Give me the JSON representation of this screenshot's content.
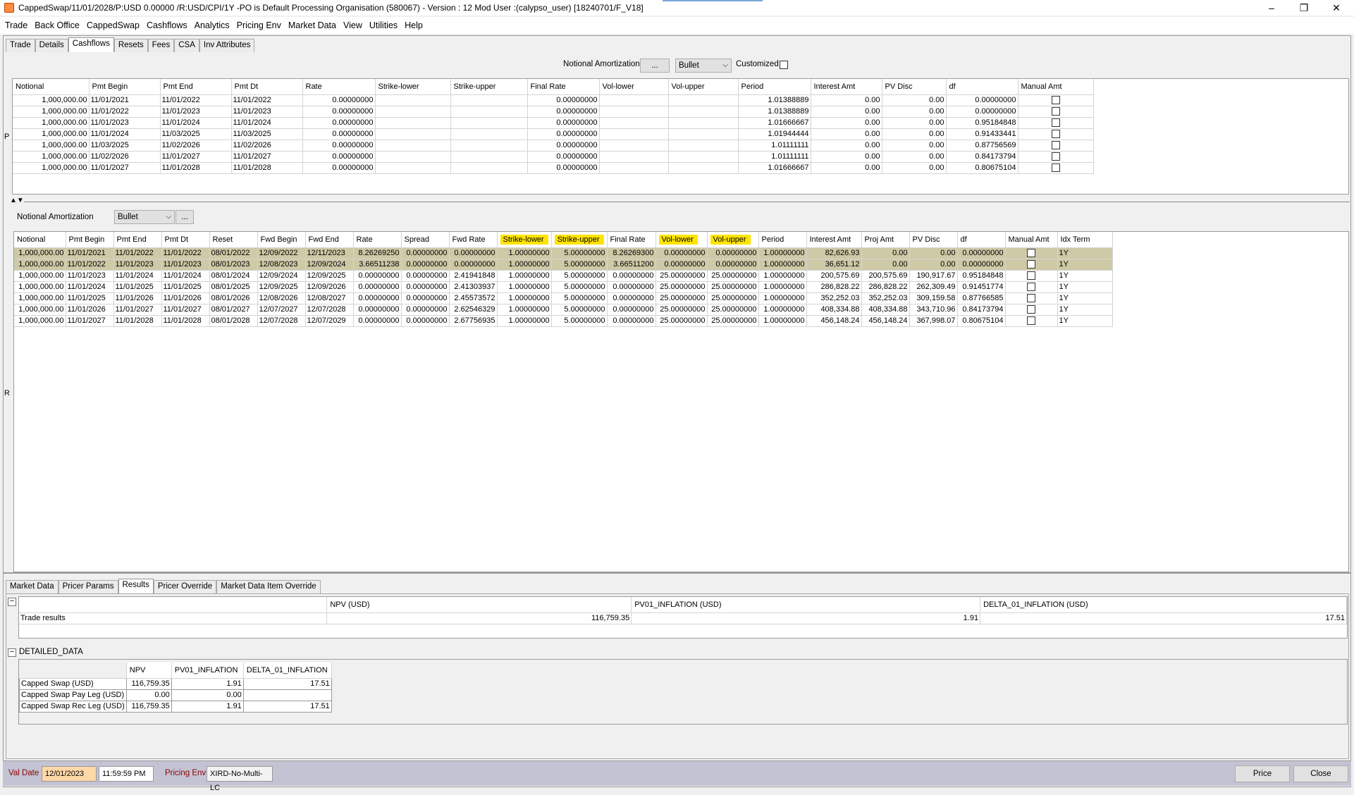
{
  "window": {
    "title": "CappedSwap/11/01/2028/P:USD 0.00000 /R:USD/CPI/1Y  -PO is Default Processing Organisation  (580067) - Version : 12 Mod User :(calypso_user)  [18240701/F_V18]",
    "minimize": "–",
    "restore": "❐",
    "close": "✕"
  },
  "menu": [
    "Trade",
    "Back Office",
    "CappedSwap",
    "Cashflows",
    "Analytics",
    "Pricing Env",
    "Market Data",
    "View",
    "Utilities",
    "Help"
  ],
  "top_tabs": [
    {
      "label": "Trade"
    },
    {
      "label": "Details"
    },
    {
      "label": "Cashflows",
      "active": true
    },
    {
      "label": "Resets"
    },
    {
      "label": "Fees"
    },
    {
      "label": "CSA"
    },
    {
      "label": "Inv Attributes"
    }
  ],
  "pay_leg": {
    "side_label": "P",
    "amort_label": "Notional Amortization",
    "amort_button": "...",
    "amort_value": "Bullet",
    "customized_label": "Customized",
    "columns": [
      "Notional",
      "Pmt Begin",
      "Pmt End",
      "Pmt Dt",
      "Rate",
      "Strike-lower",
      "Strike-upper",
      "Final Rate",
      "Vol-lower",
      "Vol-upper",
      "Period",
      "Interest Amt",
      "PV Disc",
      "df",
      "Manual Amt"
    ],
    "rows": [
      [
        "1,000,000.00",
        "11/01/2021",
        "11/01/2022",
        "11/01/2022",
        "0.00000000",
        "",
        "",
        "0.00000000",
        "",
        "",
        "1.01388889",
        "0.00",
        "0.00",
        "0.00000000"
      ],
      [
        "1,000,000.00",
        "11/01/2022",
        "11/01/2023",
        "11/01/2023",
        "0.00000000",
        "",
        "",
        "0.00000000",
        "",
        "",
        "1.01388889",
        "0.00",
        "0.00",
        "0.00000000"
      ],
      [
        "1,000,000.00",
        "11/01/2023",
        "11/01/2024",
        "11/01/2024",
        "0.00000000",
        "",
        "",
        "0.00000000",
        "",
        "",
        "1.01666667",
        "0.00",
        "0.00",
        "0.95184848"
      ],
      [
        "1,000,000.00",
        "11/01/2024",
        "11/03/2025",
        "11/03/2025",
        "0.00000000",
        "",
        "",
        "0.00000000",
        "",
        "",
        "1.01944444",
        "0.00",
        "0.00",
        "0.91433441"
      ],
      [
        "1,000,000.00",
        "11/03/2025",
        "11/02/2026",
        "11/02/2026",
        "0.00000000",
        "",
        "",
        "0.00000000",
        "",
        "",
        "1.01111111",
        "0.00",
        "0.00",
        "0.87756569"
      ],
      [
        "1,000,000.00",
        "11/02/2026",
        "11/01/2027",
        "11/01/2027",
        "0.00000000",
        "",
        "",
        "0.00000000",
        "",
        "",
        "1.01111111",
        "0.00",
        "0.00",
        "0.84173794"
      ],
      [
        "1,000,000.00",
        "11/01/2027",
        "11/01/2028",
        "11/01/2028",
        "0.00000000",
        "",
        "",
        "0.00000000",
        "",
        "",
        "1.01666667",
        "0.00",
        "0.00",
        "0.80675104"
      ]
    ]
  },
  "rec_leg": {
    "side_label": "R",
    "amort_label": "Notional Amortization",
    "amort_value": "Bullet",
    "amort_button": "...",
    "columns": [
      "Notional",
      "Pmt Begin",
      "Pmt End",
      "Pmt Dt",
      "Reset",
      "Fwd Begin",
      "Fwd End",
      "Rate",
      "Spread",
      "Fwd Rate",
      "Strike-lower",
      "Strike-upper",
      "Final Rate",
      "Vol-lower",
      "Vol-upper",
      "Period",
      "Interest Amt",
      "Proj Amt",
      "PV Disc",
      "df",
      "Manual Amt",
      "Idx Term"
    ],
    "highlight_cols": [
      10,
      11,
      13,
      14
    ],
    "rows": [
      [
        "1,000,000.00",
        "11/01/2021",
        "11/01/2022",
        "11/01/2022",
        "08/01/2022",
        "12/09/2022",
        "12/11/2023",
        "8.26269250",
        "0.00000000",
        "0.00000000",
        "1.00000000",
        "5.00000000",
        "8.26269300",
        "0.00000000",
        "0.00000000",
        "1.00000000",
        "82,626.93",
        "0.00",
        "0.00",
        "0.00000000",
        "",
        "1Y"
      ],
      [
        "1,000,000.00",
        "11/01/2022",
        "11/01/2023",
        "11/01/2023",
        "08/01/2023",
        "12/08/2023",
        "12/09/2024",
        "3.66511238",
        "0.00000000",
        "0.00000000",
        "1.00000000",
        "5.00000000",
        "3.66511200",
        "0.00000000",
        "0.00000000",
        "1.00000000",
        "36,651.12",
        "0.00",
        "0.00",
        "0.00000000",
        "",
        "1Y"
      ],
      [
        "1,000,000.00",
        "11/01/2023",
        "11/01/2024",
        "11/01/2024",
        "08/01/2024",
        "12/09/2024",
        "12/09/2025",
        "0.00000000",
        "0.00000000",
        "2.41941848",
        "1.00000000",
        "5.00000000",
        "0.00000000",
        "25.00000000",
        "25.00000000",
        "1.00000000",
        "200,575.69",
        "200,575.69",
        "190,917.67",
        "0.95184848",
        "",
        "1Y"
      ],
      [
        "1,000,000.00",
        "11/01/2024",
        "11/01/2025",
        "11/01/2025",
        "08/01/2025",
        "12/09/2025",
        "12/09/2026",
        "0.00000000",
        "0.00000000",
        "2.41303937",
        "1.00000000",
        "5.00000000",
        "0.00000000",
        "25.00000000",
        "25.00000000",
        "1.00000000",
        "286,828.22",
        "286,828.22",
        "262,309.49",
        "0.91451774",
        "",
        "1Y"
      ],
      [
        "1,000,000.00",
        "11/01/2025",
        "11/01/2026",
        "11/01/2026",
        "08/01/2026",
        "12/08/2026",
        "12/08/2027",
        "0.00000000",
        "0.00000000",
        "2.45573572",
        "1.00000000",
        "5.00000000",
        "0.00000000",
        "25.00000000",
        "25.00000000",
        "1.00000000",
        "352,252.03",
        "352,252.03",
        "309,159.58",
        "0.87766585",
        "",
        "1Y"
      ],
      [
        "1,000,000.00",
        "11/01/2026",
        "11/01/2027",
        "11/01/2027",
        "08/01/2027",
        "12/07/2027",
        "12/07/2028",
        "0.00000000",
        "0.00000000",
        "2.62546329",
        "1.00000000",
        "5.00000000",
        "0.00000000",
        "25.00000000",
        "25.00000000",
        "1.00000000",
        "408,334.88",
        "408,334.88",
        "343,710.96",
        "0.84173794",
        "",
        "1Y"
      ],
      [
        "1,000,000.00",
        "11/01/2027",
        "11/01/2028",
        "11/01/2028",
        "08/01/2028",
        "12/07/2028",
        "12/07/2029",
        "0.00000000",
        "0.00000000",
        "2.67756935",
        "1.00000000",
        "5.00000000",
        "0.00000000",
        "25.00000000",
        "25.00000000",
        "1.00000000",
        "456,148.24",
        "456,148.24",
        "367,998.07",
        "0.80675104",
        "",
        "1Y"
      ]
    ]
  },
  "bottom_tabs": [
    {
      "label": "Market Data"
    },
    {
      "label": "Pricer Params"
    },
    {
      "label": "Results",
      "active": true
    },
    {
      "label": "Pricer Override"
    },
    {
      "label": "Market Data Item Override"
    }
  ],
  "results": {
    "toggle": "−",
    "columns": [
      "",
      "NPV (USD)",
      "PV01_INFLATION (USD)",
      "DELTA_01_INFLATION (USD)"
    ],
    "row": [
      "Trade results",
      "116,759.35",
      "1.91",
      "17.51"
    ],
    "detailed_label": "DETAILED_DATA",
    "detailed_toggle": "−",
    "detailed_columns": [
      "",
      "NPV",
      "PV01_INFLATION",
      "DELTA_01_INFLATION"
    ],
    "detailed_rows": [
      [
        "Capped Swap (USD)",
        "116,759.35",
        "1.91",
        "17.51"
      ],
      [
        "Capped Swap Pay Leg (USD)",
        "0.00",
        "0.00",
        ""
      ],
      [
        "Capped Swap Rec Leg (USD)",
        "116,759.35",
        "1.91",
        "17.51"
      ]
    ]
  },
  "footer": {
    "val_date_label": "Val Date",
    "val_date": "12/01/2023",
    "val_time": "11:59:59 PM",
    "pricing_env_label": "Pricing Env",
    "pricing_env": "XIRD-No-Multi-LC",
    "price_button": "Price",
    "close_button": "Close"
  },
  "colors": {
    "selected_row": "#cec9a6",
    "highlight": "#ffe400",
    "footer_bg": "#c3c3d4",
    "val_date_bg": "#ffd8a8"
  }
}
